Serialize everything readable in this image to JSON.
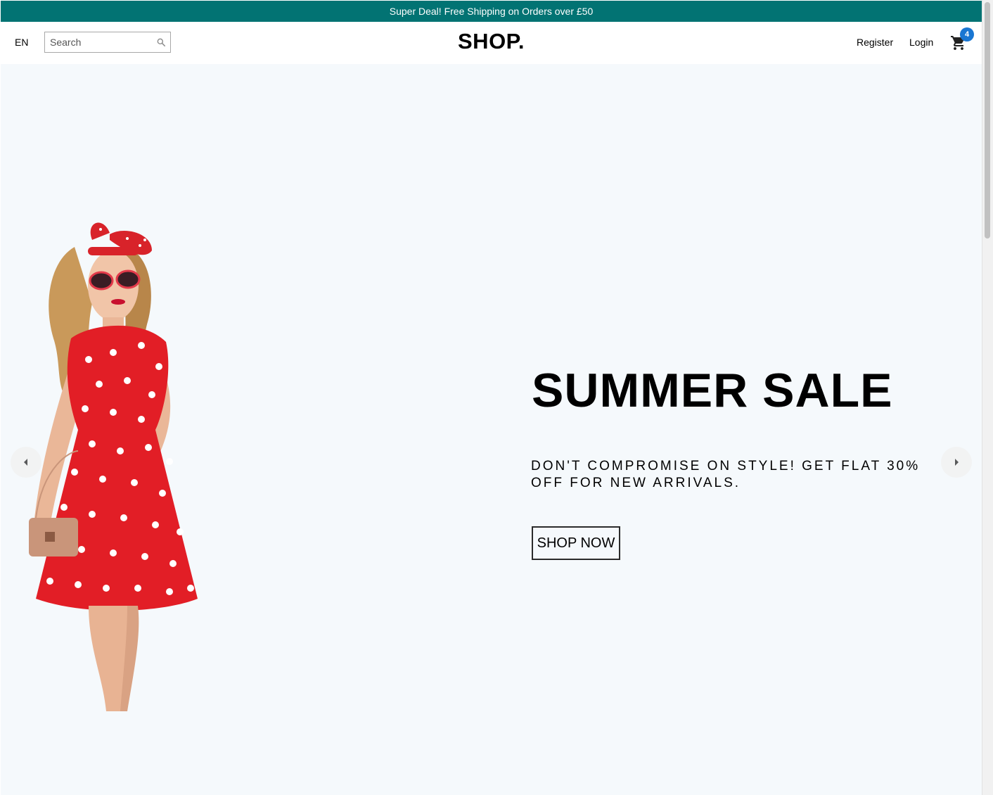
{
  "announcement": {
    "text": "Super Deal! Free Shipping on Orders over £50",
    "bg_color": "#027373"
  },
  "navbar": {
    "language": "EN",
    "search": {
      "placeholder": "Search",
      "value": "",
      "icon": "search-icon"
    },
    "logo": "SHOP.",
    "links": {
      "register": "Register",
      "login": "Login"
    },
    "cart": {
      "icon": "shopping-cart-icon",
      "count": "4",
      "badge_color": "#1976d2"
    }
  },
  "slider": {
    "bg_color": "#f5f9fc",
    "slide": {
      "title": "SUMMER SALE",
      "description": "DON'T COMPROMISE ON STYLE! GET FLAT 30% OFF FOR NEW ARRIVALS.",
      "button_label": "SHOP NOW",
      "image": "model in red polka-dot dress"
    },
    "arrows": {
      "left": "arrow-left-icon",
      "right": "arrow-right-icon"
    }
  }
}
